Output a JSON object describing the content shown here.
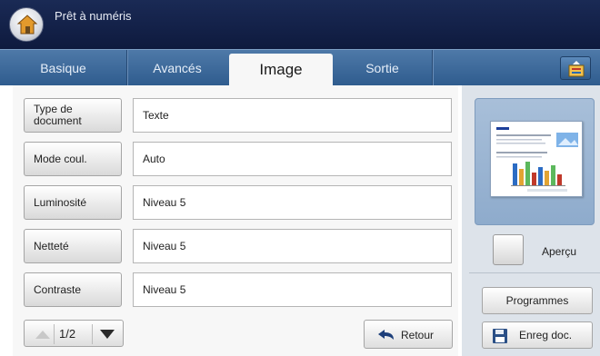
{
  "window": {
    "title": "Prêt à numéris"
  },
  "tabs": [
    {
      "label": "Basique",
      "active": false
    },
    {
      "label": "Avancés",
      "active": false
    },
    {
      "label": "Image",
      "active": true
    },
    {
      "label": "Sortie",
      "active": false
    }
  ],
  "settings": [
    {
      "label": "Type de document",
      "value": "Texte"
    },
    {
      "label": "Mode coul.",
      "value": "Auto"
    },
    {
      "label": "Luminosité",
      "value": "Niveau 5"
    },
    {
      "label": "Netteté",
      "value": "Niveau 5"
    },
    {
      "label": "Contraste",
      "value": "Niveau 5"
    }
  ],
  "pager": {
    "page": "1/2"
  },
  "buttons": {
    "back": "Retour",
    "preview": "Aperçu",
    "programs": "Programmes",
    "save_doc": "Enreg doc."
  },
  "icons": {
    "home": "home-icon",
    "corner": "job-status-icon",
    "back": "return-arrow-icon",
    "save": "floppy-disk-icon",
    "up": "arrow-up-icon",
    "down": "arrow-down-icon"
  },
  "colors": {
    "title_bar": "#0e1a3e",
    "tab_bar": "#2f5c8e",
    "preview_panel": "#8eabcc",
    "sidebar": "#dde3ea"
  }
}
